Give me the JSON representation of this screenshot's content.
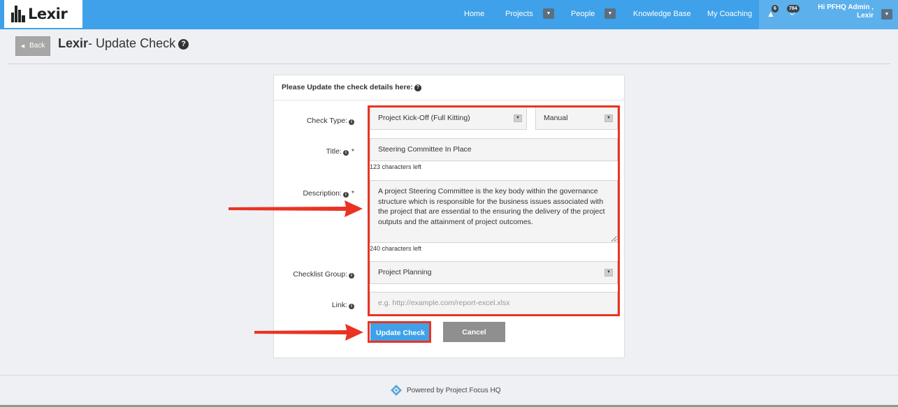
{
  "brand": {
    "name": "Lexir"
  },
  "nav": {
    "home": "Home",
    "projects": "Projects",
    "people": "People",
    "knowledge_base": "Knowledge Base",
    "my_coaching": "My Coaching",
    "alerts_count": "6",
    "tasks_count": "784",
    "user_greeting": "Hi PFHQ Admin ,",
    "user_company": "Lexir"
  },
  "header": {
    "back_label": "Back",
    "title_brand": "Lexir",
    "title_rest": "- Update Check"
  },
  "form": {
    "heading": "Please Update the check details here:",
    "check_type_label": "Check Type:",
    "check_type_value": "Project Kick-Off (Full Kitting)",
    "check_mode_value": "Manual",
    "title_label": "Title:",
    "title_value": "Steering Committee In Place",
    "title_counter": "123 characters left",
    "description_label": "Description:",
    "description_value": "A project Steering Committee is the key body within the governance structure which is responsible for the business issues associated with the project that are essential to the ensuring the delivery of the project outputs and the attainment of project outcomes.",
    "description_counter": "240 characters left",
    "group_label": "Checklist Group:",
    "group_value": "Project Planning",
    "link_label": "Link:",
    "link_placeholder": "e.g. http://example.com/report-excel.xlsx",
    "update_button": "Update Check",
    "cancel_button": "Cancel",
    "required_mark": "*"
  },
  "footer": {
    "text": "Powered by Project Focus HQ"
  },
  "colors": {
    "navbar": "#3fa1e9",
    "primary_button": "#3fa1e9",
    "cancel_button": "#8f8f8f",
    "highlight": "#ea3323"
  }
}
